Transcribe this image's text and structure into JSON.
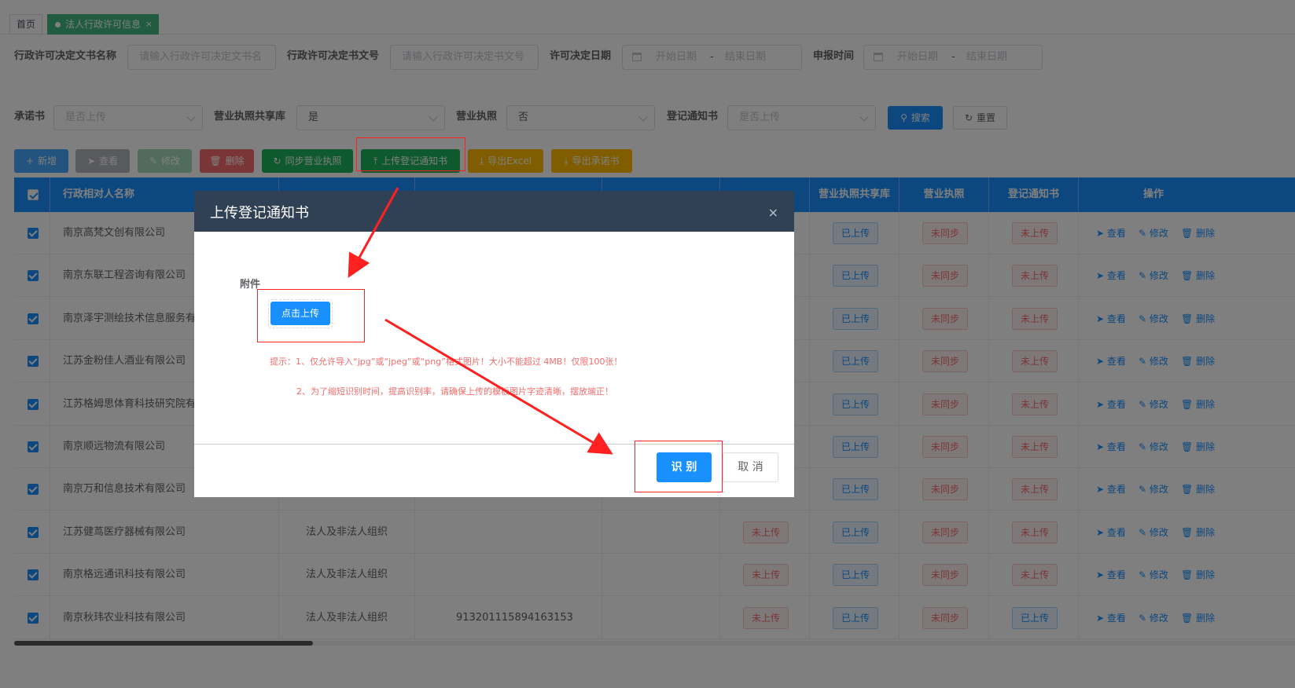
{
  "tabs": {
    "home": "首页",
    "active": "法人行政许可信息",
    "close": "×"
  },
  "search": {
    "doc_name_label": "行政许可决定文书名称",
    "doc_name_placeholder": "请输入行政许可决定文书名",
    "doc_no_label": "行政许可决定书文号",
    "doc_no_placeholder": "请输入行政许可决定书文号",
    "decision_date_label": "许可决定日期",
    "start_date": "开始日期",
    "range_sep": "-",
    "end_date": "结束日期",
    "report_time_label": "申报时间",
    "commitment_label": "承诺书",
    "commitment_placeholder": "是否上传",
    "license_share_label": "营业执照共享库",
    "license_share_value": "是",
    "license_label": "营业执照",
    "license_value": "否",
    "notice_label": "登记通知书",
    "notice_placeholder": "是否上传",
    "search_btn": "搜索",
    "reset_btn": "重置"
  },
  "toolbar": {
    "add": "新增",
    "view": "查看",
    "edit": "修改",
    "delete": "删除",
    "sync_license": "同步营业执照",
    "upload_notice": "上传登记通知书",
    "export_excel": "导出Excel",
    "export_commitment": "导出承诺书"
  },
  "table": {
    "headers": {
      "name": "行政相对人名称",
      "license_share": "营业执照共享库",
      "license": "营业执照",
      "notice": "登记通知书",
      "ops": "操作"
    },
    "op_labels": {
      "view": "查看",
      "edit": "修改",
      "delete": "删除"
    },
    "rows": [
      {
        "name": "南京高梵文创有限公司",
        "type": "",
        "code": "",
        "commit": "",
        "share": "已上传",
        "license": "未同步",
        "notice": "未上传"
      },
      {
        "name": "南京东联工程咨询有限公司",
        "type": "",
        "code": "",
        "commit": "",
        "share": "已上传",
        "license": "未同步",
        "notice": "未上传"
      },
      {
        "name": "南京泽宇测绘技术信息服务有",
        "type": "",
        "code": "",
        "commit": "",
        "share": "已上传",
        "license": "未同步",
        "notice": "未上传"
      },
      {
        "name": "江苏金粉佳人酒业有限公司",
        "type": "",
        "code": "",
        "commit": "",
        "share": "已上传",
        "license": "未同步",
        "notice": "未上传"
      },
      {
        "name": "江苏格姆思体育科技研究院有",
        "type": "",
        "code": "",
        "commit": "",
        "share": "已上传",
        "license": "未同步",
        "notice": "未上传"
      },
      {
        "name": "南京顺远物流有限公司",
        "type": "",
        "code": "",
        "commit": "",
        "share": "已上传",
        "license": "未同步",
        "notice": "未上传"
      },
      {
        "name": "南京万和信息技术有限公司",
        "type": "",
        "code": "",
        "commit": "",
        "share": "已上传",
        "license": "未同步",
        "notice": "未上传"
      },
      {
        "name": "江苏健茑医疗器械有限公司",
        "type": "法人及非法人组织",
        "code": "",
        "commit": "未上传",
        "share": "已上传",
        "license": "未同步",
        "notice": "未上传"
      },
      {
        "name": "南京格远通讯科技有限公司",
        "type": "法人及非法人组织",
        "code": "",
        "commit": "未上传",
        "share": "已上传",
        "license": "未同步",
        "notice": "未上传"
      },
      {
        "name": "南京秋玮农业科技有限公司",
        "type": "法人及非法人组织",
        "code": "913201115894163153",
        "commit": "未上传",
        "share": "已上传",
        "license": "未同步",
        "notice": "已上传"
      }
    ]
  },
  "dialog": {
    "title": "上传登记通知书",
    "close": "×",
    "attachment_label": "附件",
    "upload_btn": "点击上传",
    "hint1": "提示：1、仅允许导入“jpg”或“jpeg”或“png”格式图片！大小不能超过 4MB！仅限100张！",
    "hint2": "2、为了缩短识别时间，提高识别率，请确保上传的模板图片字迹清晰，摆放端正！",
    "recognize_btn": "识 别",
    "cancel_btn": "取 消"
  },
  "colors": {
    "primary": "#1890ff",
    "dialog_header": "#304156",
    "annotation": "#ff2020"
  }
}
